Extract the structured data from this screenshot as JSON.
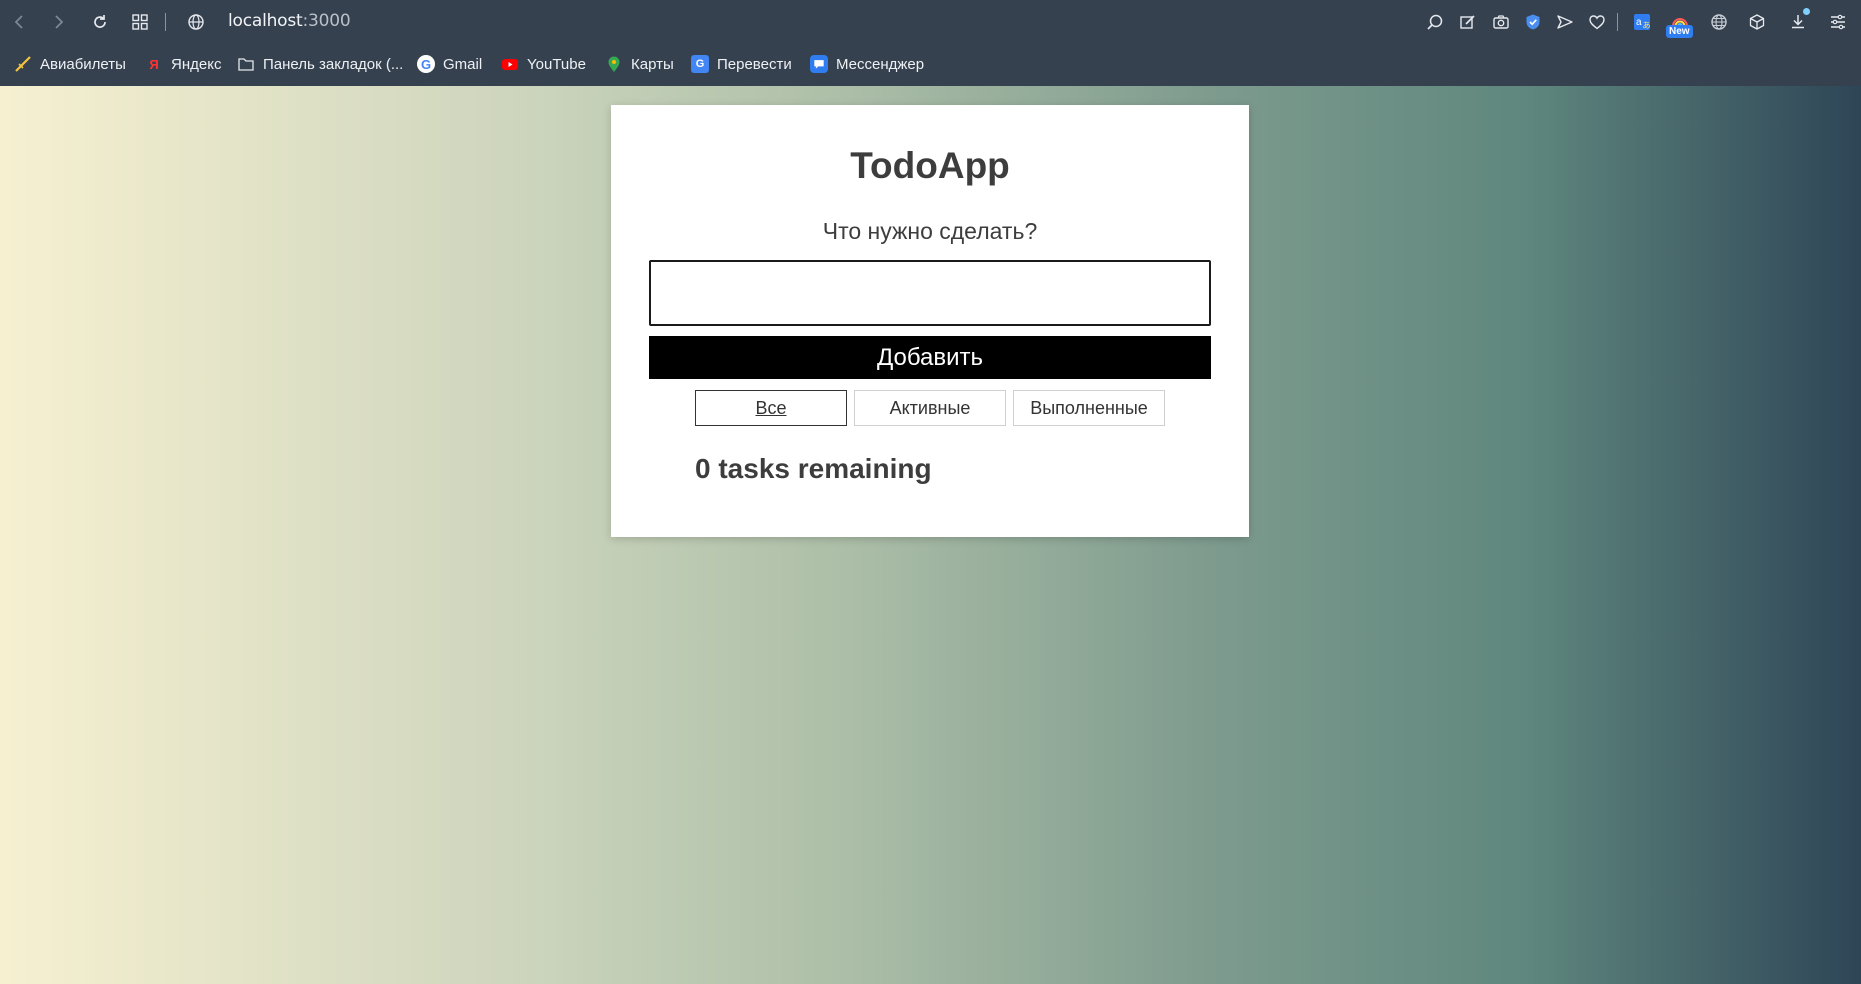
{
  "browser": {
    "url_host": "localhost",
    "url_port": ":3000",
    "new_badge": "New",
    "bookmarks": [
      {
        "label": "Авиабилеты",
        "icon": "plane-icon"
      },
      {
        "label": "Яндекс",
        "icon": "yandex-icon",
        "glyph": "Я"
      },
      {
        "label": "Панель закладок (...",
        "icon": "folder-icon"
      },
      {
        "label": "Gmail",
        "icon": "google-icon",
        "glyph": "G"
      },
      {
        "label": "YouTube",
        "icon": "youtube-icon"
      },
      {
        "label": "Карты",
        "icon": "maps-pin-icon"
      },
      {
        "label": "Перевести",
        "icon": "translate-icon",
        "glyph": "G"
      },
      {
        "label": "Мессенджер",
        "icon": "messenger-icon"
      }
    ]
  },
  "app": {
    "title": "TodoApp",
    "prompt": "Что нужно сделать?",
    "input_value": "",
    "add_button": "Добавить",
    "filters": [
      {
        "label": "Все",
        "active": true
      },
      {
        "label": "Активные",
        "active": false
      },
      {
        "label": "Выполненные",
        "active": false
      }
    ],
    "remaining": "0 tasks remaining"
  },
  "colors": {
    "chrome_bg": "#35414f",
    "gradient_start": "#f6f0d1",
    "gradient_end": "#2e4556",
    "button_bg": "#000000",
    "text": "#3d3d3d"
  }
}
